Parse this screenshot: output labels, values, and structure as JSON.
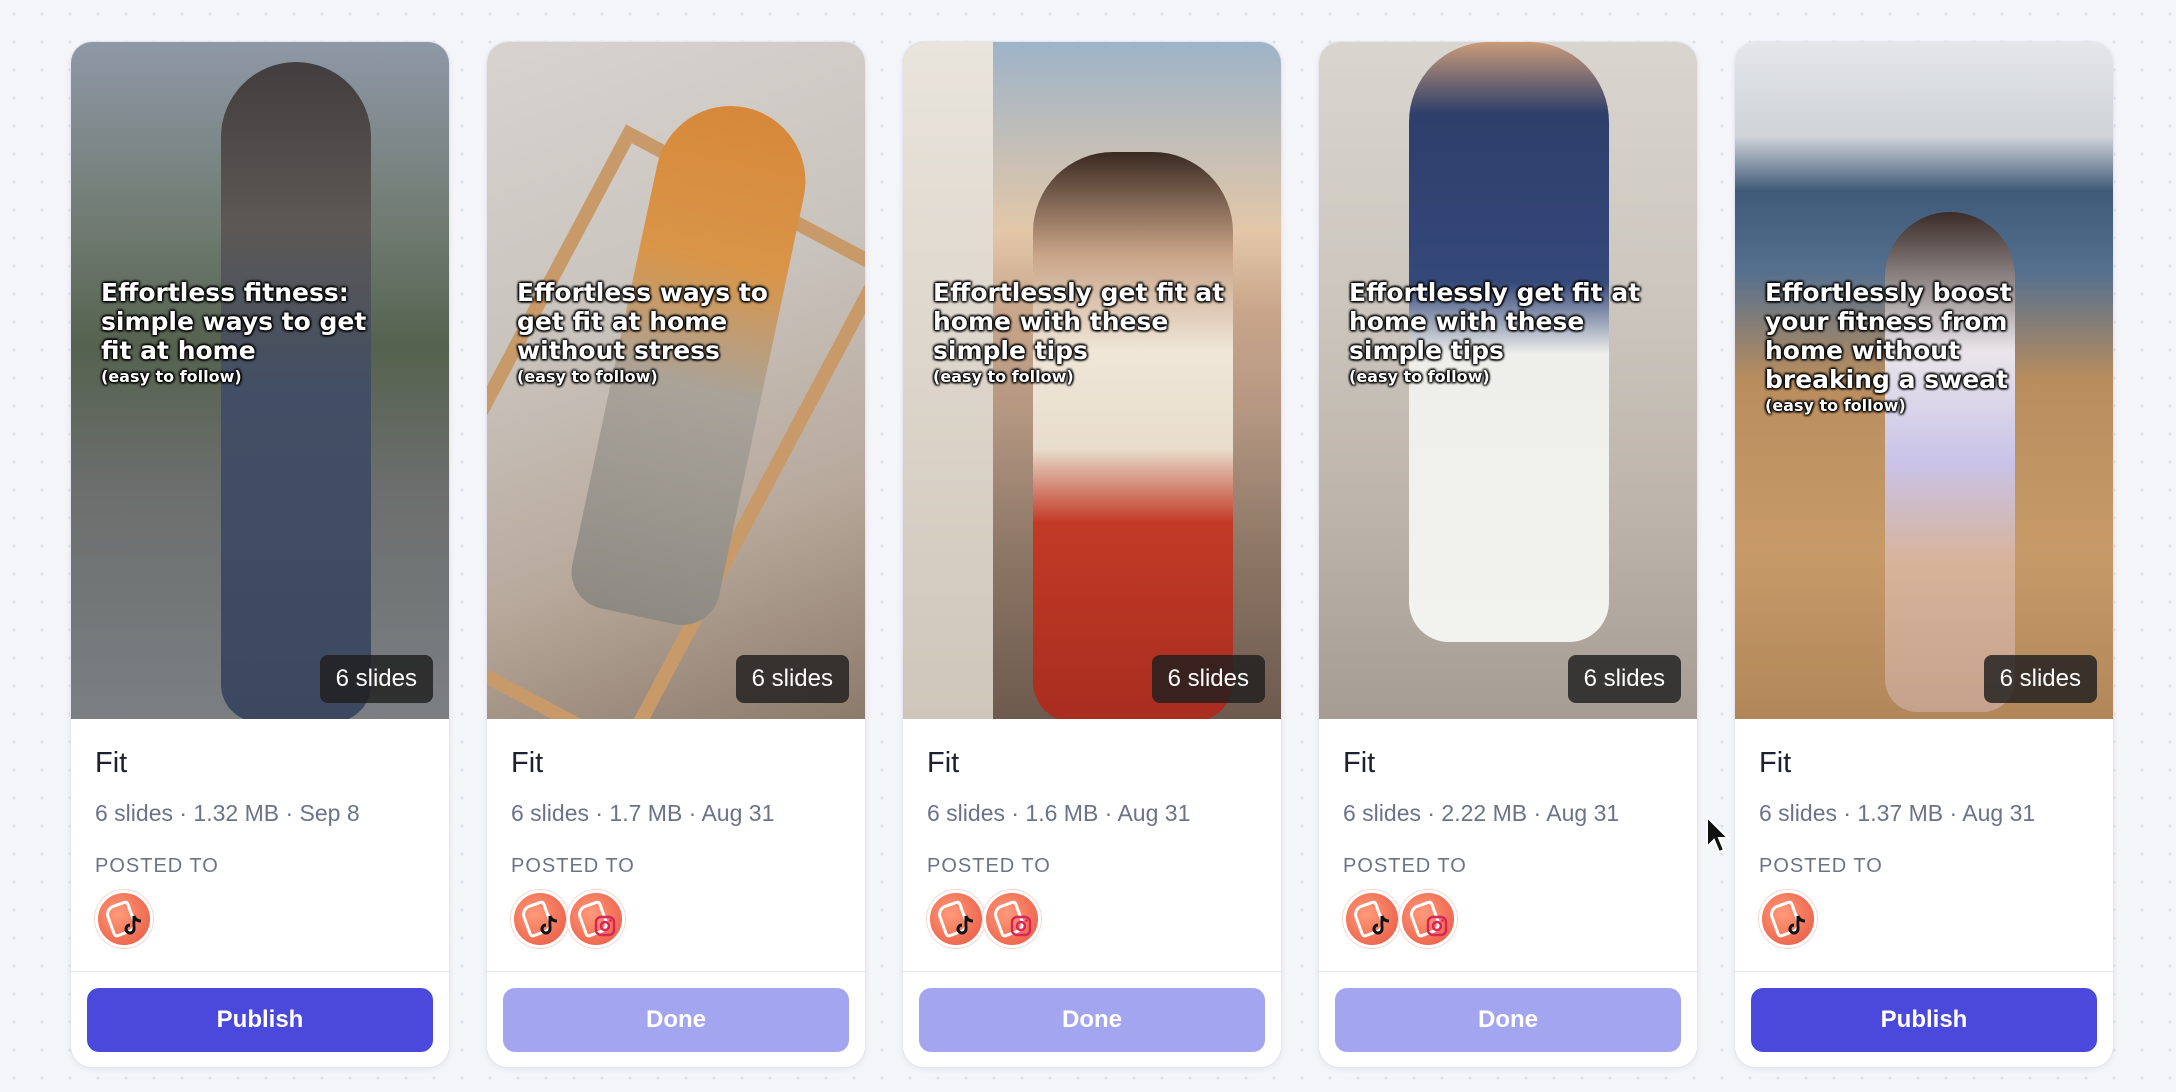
{
  "colors": {
    "accent": "#4a49dc",
    "done": "#a3a5ee",
    "avatar": "#e8543e",
    "text_primary": "#1c2030",
    "text_secondary": "#6a7388"
  },
  "posted_to_label": "POSTED TO",
  "cards": [
    {
      "overlay_title": "Effortless fitness: simple ways to get fit at home",
      "overlay_sub": "(easy to follow)",
      "badge": "6 slides",
      "title": "Fit",
      "meta": "6 slides · 1.32 MB · Sep 8",
      "platforms": [
        "tiktok"
      ],
      "button": "Publish",
      "button_state": "publish"
    },
    {
      "overlay_title": "Effortless ways to get fit at home without stress",
      "overlay_sub": "(easy to follow)",
      "badge": "6 slides",
      "title": "Fit",
      "meta": "6 slides · 1.7 MB · Aug 31",
      "platforms": [
        "tiktok",
        "instagram"
      ],
      "button": "Done",
      "button_state": "done"
    },
    {
      "overlay_title": "Effortlessly get fit at home with these simple tips",
      "overlay_sub": "(easy to follow)",
      "badge": "6 slides",
      "title": "Fit",
      "meta": "6 slides · 1.6 MB · Aug 31",
      "platforms": [
        "tiktok",
        "instagram"
      ],
      "button": "Done",
      "button_state": "done"
    },
    {
      "overlay_title": "Effortlessly get fit at home with these simple tips",
      "overlay_sub": "(easy to follow)",
      "badge": "6 slides",
      "title": "Fit",
      "meta": "6 slides · 2.22 MB · Aug 31",
      "platforms": [
        "tiktok",
        "instagram"
      ],
      "button": "Done",
      "button_state": "done"
    },
    {
      "overlay_title": "Effortlessly boost your fitness from home without breaking a sweat",
      "overlay_sub": "(easy to follow)",
      "badge": "6 slides",
      "title": "Fit",
      "meta": "6 slides · 1.37 MB · Aug 31",
      "platforms": [
        "tiktok"
      ],
      "button": "Publish",
      "button_state": "publish"
    }
  ]
}
